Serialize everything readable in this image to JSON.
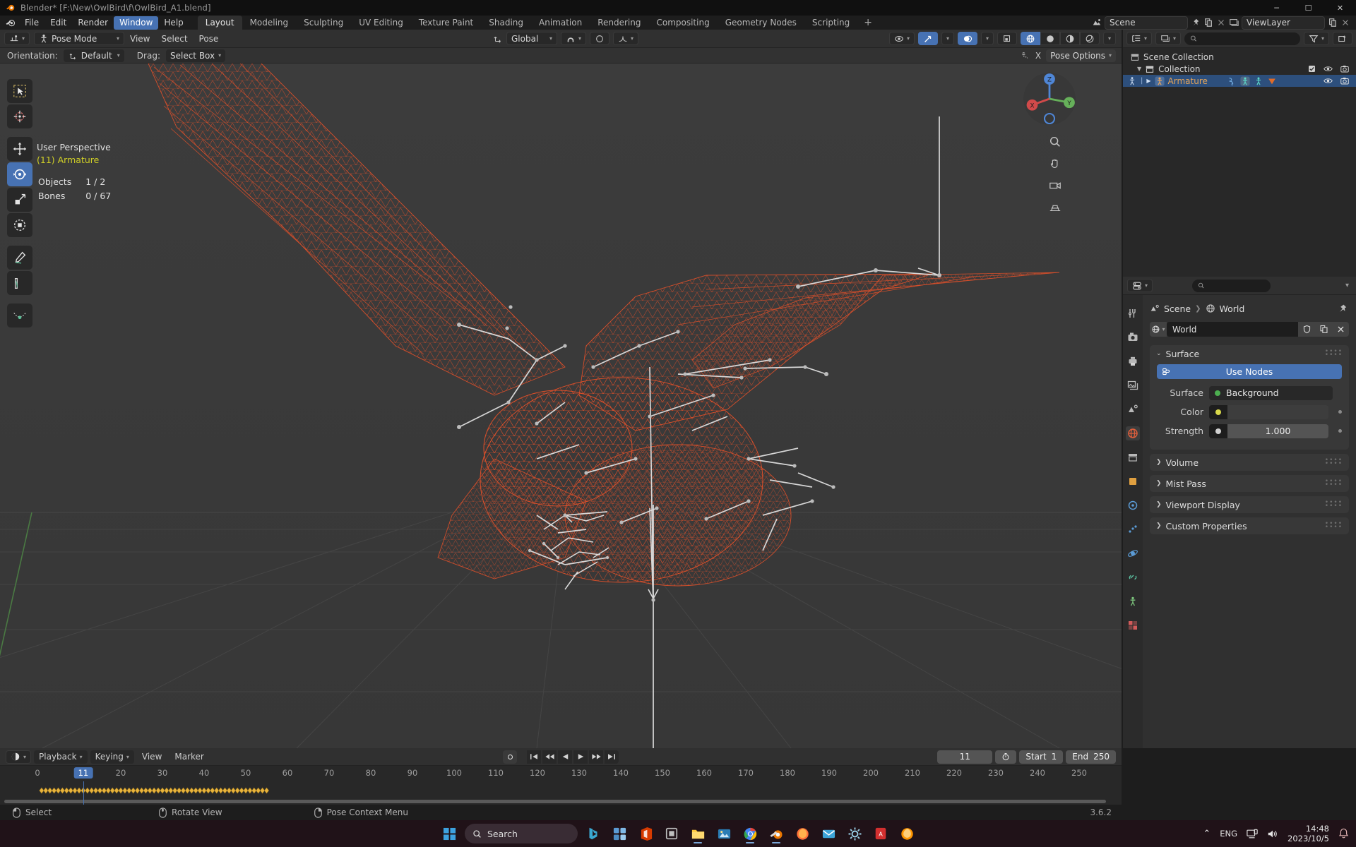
{
  "titlebar": {
    "title": "Blender* [F:\\New\\OwlBird\\f\\OwlBird_A1.blend]",
    "minimize": "─",
    "maximize": "☐",
    "close": "✕"
  },
  "menubar": {
    "items": [
      {
        "label": "File",
        "active": false
      },
      {
        "label": "Edit",
        "active": false
      },
      {
        "label": "Render",
        "active": false
      },
      {
        "label": "Window",
        "active": true
      },
      {
        "label": "Help",
        "active": false
      }
    ],
    "workspace_tabs": [
      {
        "label": "Layout",
        "active": true
      },
      {
        "label": "Modeling",
        "active": false
      },
      {
        "label": "Sculpting",
        "active": false
      },
      {
        "label": "UV Editing",
        "active": false
      },
      {
        "label": "Texture Paint",
        "active": false
      },
      {
        "label": "Shading",
        "active": false
      },
      {
        "label": "Animation",
        "active": false
      },
      {
        "label": "Rendering",
        "active": false
      },
      {
        "label": "Compositing",
        "active": false
      },
      {
        "label": "Geometry Nodes",
        "active": false
      },
      {
        "label": "Scripting",
        "active": false
      }
    ],
    "add_workspace": "+",
    "scene_name": "Scene",
    "viewlayer_name": "ViewLayer"
  },
  "viewport_header": {
    "mode": "Pose Mode",
    "menus": [
      "View",
      "Select",
      "Pose"
    ],
    "transform_orientation": "Global"
  },
  "tool_settings": {
    "orientation_label": "Orientation:",
    "orientation_value": "Default",
    "drag_label": "Drag:",
    "drag_value": "Select Box",
    "pose_options": "Pose Options",
    "mirror_x": "X"
  },
  "viewport": {
    "perspective": "User Perspective",
    "active_object": "(11) Armature",
    "stats": [
      {
        "label": "Objects",
        "value": "1 / 2"
      },
      {
        "label": "Bones",
        "value": "0 / 67"
      }
    ],
    "gizmo_axes": {
      "x": "X",
      "y": "Y",
      "z": "Z"
    },
    "tools": [
      "tweak-select-tool",
      "cursor-tool",
      "move-tool",
      "rotate-tool",
      "scale-tool",
      "transform-tool",
      "annotate-tool",
      "measure-tool",
      "breakdowner-tool"
    ],
    "active_tool": "rotate-tool",
    "mesh_color": "#e0502a",
    "bone_color": "#d8d8d8"
  },
  "outliner": {
    "display_mode": "View Layer",
    "search_placeholder": "",
    "rows": [
      {
        "label": "Scene Collection",
        "indent": 0,
        "selected": false,
        "type": "collection",
        "has_disclosure": false,
        "icons": []
      },
      {
        "label": "Collection",
        "indent": 1,
        "selected": false,
        "type": "collection",
        "has_disclosure": true,
        "icons": [
          "checkbox",
          "eye",
          "camera"
        ]
      },
      {
        "label": "Armature",
        "indent": 2,
        "selected": true,
        "type": "armature",
        "has_disclosure": true,
        "icons": [
          "eye",
          "camera"
        ]
      }
    ]
  },
  "properties": {
    "breadcrumb": [
      "Scene",
      "World"
    ],
    "datablock_name": "World",
    "panels": [
      {
        "title": "Surface",
        "open": true
      },
      {
        "title": "Volume",
        "open": false
      },
      {
        "title": "Mist Pass",
        "open": false
      },
      {
        "title": "Viewport Display",
        "open": false
      },
      {
        "title": "Custom Properties",
        "open": false
      }
    ],
    "use_nodes_label": "Use Nodes",
    "fields": [
      {
        "label": "Surface",
        "value": "Background",
        "swatch": "#4caf50",
        "type": "shader"
      },
      {
        "label": "Color",
        "value": "",
        "swatch": "#d8d84a",
        "type": "color"
      },
      {
        "label": "Strength",
        "value": "1.000",
        "swatch": "#d0d0d0",
        "type": "slider"
      }
    ],
    "tab_icons": [
      "tool-tab",
      "render-tab",
      "output-tab",
      "viewlayer-tab",
      "scene-tab",
      "world-tab",
      "collection-tab",
      "object-tab",
      "modifier-tab",
      "particles-tab",
      "physics-tab",
      "constraint-tab",
      "data-tab",
      "material-tab"
    ],
    "active_tab": "world-tab"
  },
  "timeline": {
    "menus": [
      "Playback",
      "Keying",
      "View",
      "Marker"
    ],
    "current_frame": "11",
    "start_label": "Start",
    "start_value": "1",
    "end_label": "End",
    "end_value": "250",
    "ruler_ticks": [
      "0",
      "10",
      "20",
      "30",
      "40",
      "50",
      "60",
      "70",
      "80",
      "90",
      "100",
      "110",
      "120",
      "130",
      "140",
      "150",
      "160",
      "170",
      "180",
      "190",
      "200",
      "210",
      "220",
      "230",
      "240",
      "250"
    ],
    "playhead_frame": 11,
    "keyframe_range": {
      "start": 1,
      "end": 55
    },
    "playback_buttons": [
      "jump-start",
      "prev-keyframe",
      "play-reverse",
      "play",
      "next-keyframe",
      "jump-end"
    ],
    "record_button": "record"
  },
  "statusbar": {
    "items": [
      {
        "icon": "mouse-left",
        "label": "Select"
      },
      {
        "icon": "mouse-middle",
        "label": "Rotate View"
      },
      {
        "icon": "mouse-right",
        "label": "Pose Context Menu"
      }
    ],
    "version": "3.6.2"
  },
  "taskbar": {
    "search_placeholder": "Search",
    "apps": [
      {
        "name": "start-button",
        "glyph": "start",
        "color": "#3da2e0",
        "running": false
      },
      {
        "name": "search-box",
        "glyph": "search",
        "color": "",
        "running": false
      },
      {
        "name": "bing-chat-icon",
        "glyph": "b",
        "color": "#3aa7d0",
        "running": false
      },
      {
        "name": "widgets-icon",
        "glyph": "w",
        "color": "#5b9bd5",
        "running": false
      },
      {
        "name": "office-icon",
        "glyph": "o",
        "color": "#d83b01",
        "running": false
      },
      {
        "name": "snipping-tool-icon",
        "glyph": "s",
        "color": "#8b8b8b",
        "running": false
      },
      {
        "name": "explorer-icon",
        "glyph": "f",
        "color": "#ffc83d",
        "running": true
      },
      {
        "name": "photos-icon",
        "glyph": "p",
        "color": "#4da3d6",
        "running": false
      },
      {
        "name": "chrome-icon",
        "glyph": "c",
        "color": "#4285f4",
        "running": true
      },
      {
        "name": "blender-icon",
        "glyph": "bl",
        "color": "#ea7600",
        "running": true
      },
      {
        "name": "firefox-icon",
        "glyph": "fx",
        "color": "#ff7139",
        "running": false
      },
      {
        "name": "mail-icon",
        "glyph": "m",
        "color": "#3ca4d8",
        "running": false
      },
      {
        "name": "settings-icon",
        "glyph": "g",
        "color": "#9ad0e8",
        "running": false
      },
      {
        "name": "acrobat-icon",
        "glyph": "a",
        "color": "#d32f2f",
        "running": false
      },
      {
        "name": "firefox2-icon",
        "glyph": "fx2",
        "color": "#ff9500",
        "running": false
      }
    ],
    "tray": {
      "chevron": "⌃",
      "language": "ENG",
      "time": "14:48",
      "date": "2023/10/5"
    }
  }
}
